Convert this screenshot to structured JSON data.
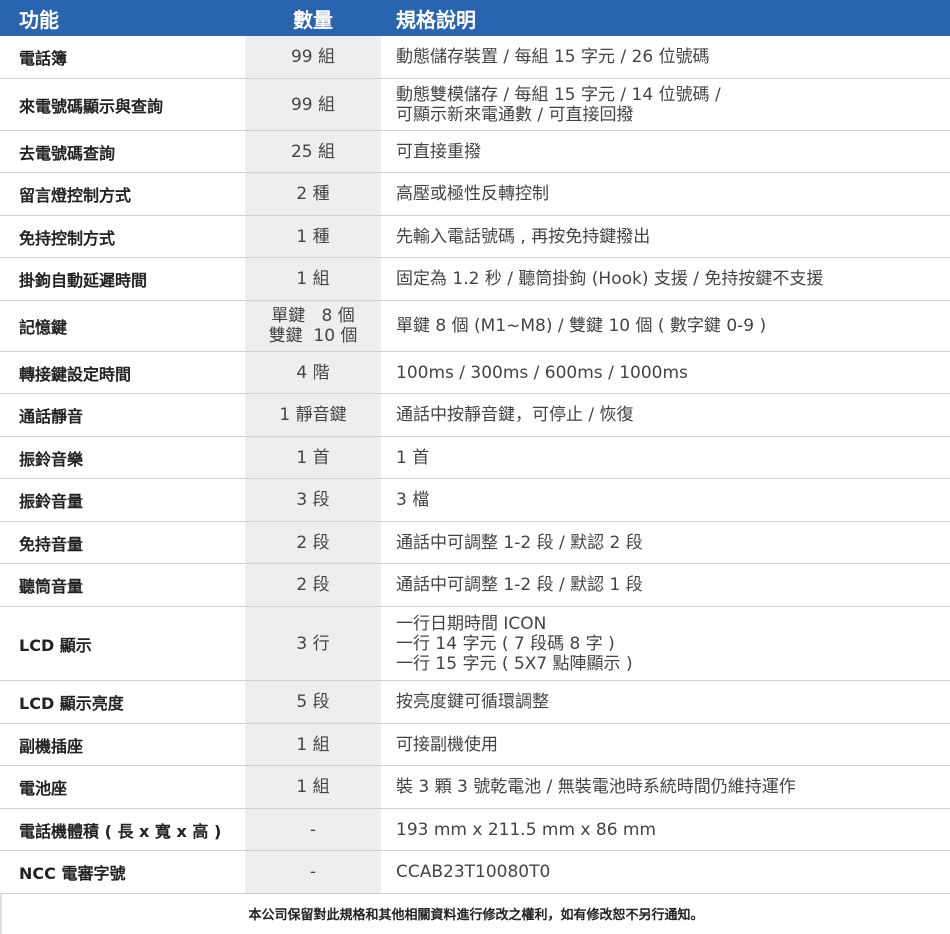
{
  "header": {
    "col_function": "功能",
    "col_quantity": "數量",
    "col_spec": "規格說明"
  },
  "rows": [
    {
      "function": "電話簿",
      "quantity": "99 組",
      "spec": [
        "動態儲存裝置 / 每組 15 字元 / 26 位號碼"
      ]
    },
    {
      "function": "來電號碼顯示與查詢",
      "quantity": "99 組",
      "spec": [
        "動態雙模儲存 / 每組 15 字元 / 14 位號碼 /",
        "可顯示新來電通數 / 可直接回撥"
      ]
    },
    {
      "function": "去電號碼查詢",
      "quantity": "25 組",
      "spec": [
        "可直接重撥"
      ]
    },
    {
      "function": "留言燈控制方式",
      "quantity": "2 種",
      "spec": [
        "高壓或極性反轉控制"
      ]
    },
    {
      "function": "免持控制方式",
      "quantity": "1 種",
      "spec": [
        "先輸入電話號碼 , 再按免持鍵撥出"
      ]
    },
    {
      "function": "掛鉤自動延遲時間",
      "quantity": "1 組",
      "spec": [
        "固定為 1.2 秒 / 聽筒掛鉤 (Hook) 支援 / 免持按鍵不支援"
      ]
    },
    {
      "function": "記憶鍵",
      "quantity": "單鍵   8 個\n雙鍵  10 個",
      "spec": [
        "單鍵 8 個 (M1~M8) / 雙鍵 10 個 ( 數字鍵 0-9 )"
      ]
    },
    {
      "function": "轉接鍵設定時間",
      "quantity": "4 階",
      "spec": [
        "100ms / 300ms / 600ms / 1000ms"
      ]
    },
    {
      "function": "通話靜音",
      "quantity": "1 靜音鍵",
      "spec": [
        "通話中按靜音鍵，可停止 / 恢復"
      ]
    },
    {
      "function": "振鈴音樂",
      "quantity": "1 首",
      "spec": [
        "1 首"
      ]
    },
    {
      "function": "振鈴音量",
      "quantity": "3 段",
      "spec": [
        "3 檔"
      ]
    },
    {
      "function": "免持音量",
      "quantity": "2 段",
      "spec": [
        "通話中可調整 1-2 段 / 默認 2 段"
      ]
    },
    {
      "function": "聽筒音量",
      "quantity": "2 段",
      "spec": [
        "通話中可調整 1-2 段 / 默認 1 段"
      ]
    },
    {
      "function": "LCD 顯示",
      "quantity": "3 行",
      "spec": [
        "一行日期時間 ICON",
        "一行 14 字元 ( 7 段碼 8 字 )",
        "一行 15 字元 ( 5X7 點陣顯示 )"
      ]
    },
    {
      "function": "LCD 顯示亮度",
      "quantity": "5 段",
      "spec": [
        "按亮度鍵可循環調整"
      ]
    },
    {
      "function": "副機插座",
      "quantity": "1 組",
      "spec": [
        "可接副機使用"
      ]
    },
    {
      "function": "電池座",
      "quantity": "1 組",
      "spec": [
        "裝 3 顆 3 號乾電池 / 無裝電池時系統時間仍維持運作"
      ]
    },
    {
      "function": "電話機體積 ( 長 x 寬 x 高 )",
      "quantity": "-",
      "spec": [
        "193 mm x 211.5 mm x 86 mm"
      ]
    },
    {
      "function": "NCC 電審字號",
      "quantity": "-",
      "spec": [
        "CCAB23T10080T0"
      ]
    }
  ],
  "footer": {
    "note": "本公司保留對此規格和其他相關資料進行修改之權利，如有修改恕不另行通知。"
  },
  "colors": {
    "header_bg": "#2a63ae",
    "quantity_bg": "#eeeeee",
    "row_border": "#cfcfcf"
  }
}
